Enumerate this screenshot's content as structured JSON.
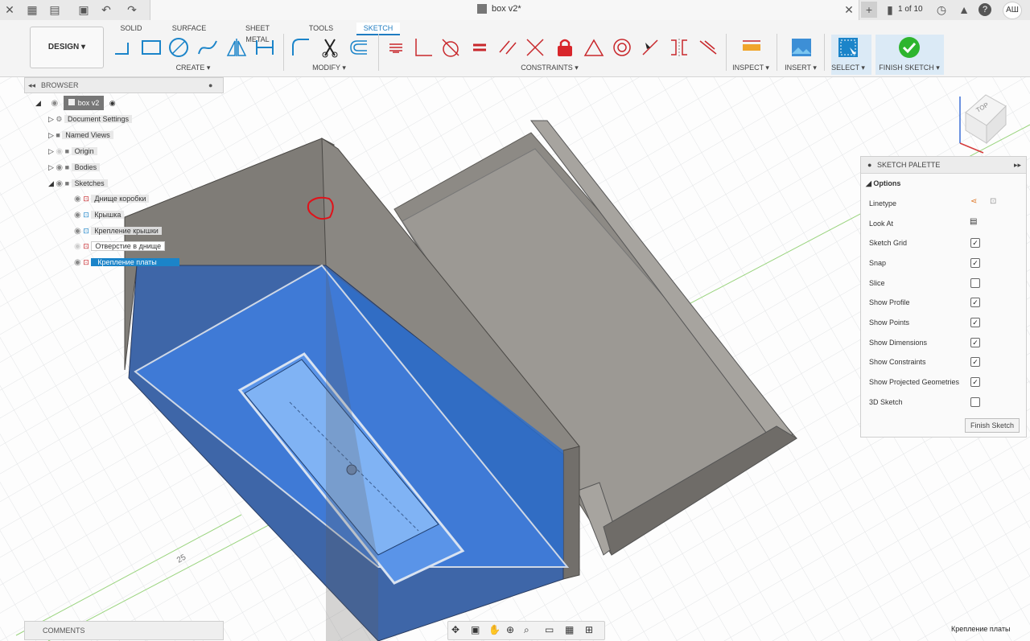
{
  "titlebar": {
    "doc_title": "box v2*",
    "page_counter": "1 of 10",
    "user_initials": "АШ"
  },
  "toolbar": {
    "design_label": "DESIGN ▾",
    "tabs": [
      "SOLID",
      "SURFACE",
      "SHEET METAL",
      "TOOLS",
      "SKETCH"
    ],
    "active_tab": "SKETCH",
    "groups": {
      "create": "CREATE ▾",
      "modify": "MODIFY ▾",
      "constraints": "CONSTRAINTS ▾",
      "inspect": "INSPECT ▾",
      "insert": "INSERT ▾",
      "select": "SELECT ▾",
      "finish": "FINISH SKETCH ▾"
    }
  },
  "browser": {
    "header": "BROWSER",
    "root": "box v2",
    "items": [
      {
        "label": "Document Settings",
        "icon": "gear-icon"
      },
      {
        "label": "Named Views",
        "icon": "folder-icon"
      },
      {
        "label": "Origin",
        "icon": "folder-icon"
      },
      {
        "label": "Bodies",
        "icon": "folder-icon"
      },
      {
        "label": "Sketches",
        "icon": "folder-icon"
      }
    ],
    "sketches": [
      {
        "label": "Днище коробки",
        "selected": false
      },
      {
        "label": "Крышка",
        "selected": false
      },
      {
        "label": "Крепление крышки",
        "selected": false
      },
      {
        "label": "Отверстие в днище",
        "selected": false
      },
      {
        "label": "Крепление платы",
        "selected": true
      }
    ]
  },
  "palette": {
    "header": "SKETCH PALETTE",
    "section": "Options",
    "rows": [
      {
        "label": "Linetype",
        "type": "icons"
      },
      {
        "label": "Look At",
        "type": "icon"
      },
      {
        "label": "Sketch Grid",
        "checked": true
      },
      {
        "label": "Snap",
        "checked": true
      },
      {
        "label": "Slice",
        "checked": false
      },
      {
        "label": "Show Profile",
        "checked": true
      },
      {
        "label": "Show Points",
        "checked": true
      },
      {
        "label": "Show Dimensions",
        "checked": true
      },
      {
        "label": "Show Constraints",
        "checked": true
      },
      {
        "label": "Show Projected Geometries",
        "checked": true
      },
      {
        "label": "3D Sketch",
        "checked": false
      }
    ],
    "finish_button": "Finish Sketch"
  },
  "viewport": {
    "dimension_label": "25",
    "viewcube_label": "TOP"
  },
  "comments": {
    "label": "COMMENTS"
  },
  "status": {
    "active_sketch": "Крепление платы"
  },
  "colors": {
    "accent": "#1b84c9",
    "profile_fill": "#2f6fc9",
    "body_grey": "#8a8782",
    "finish_green": "#2eb52e"
  }
}
